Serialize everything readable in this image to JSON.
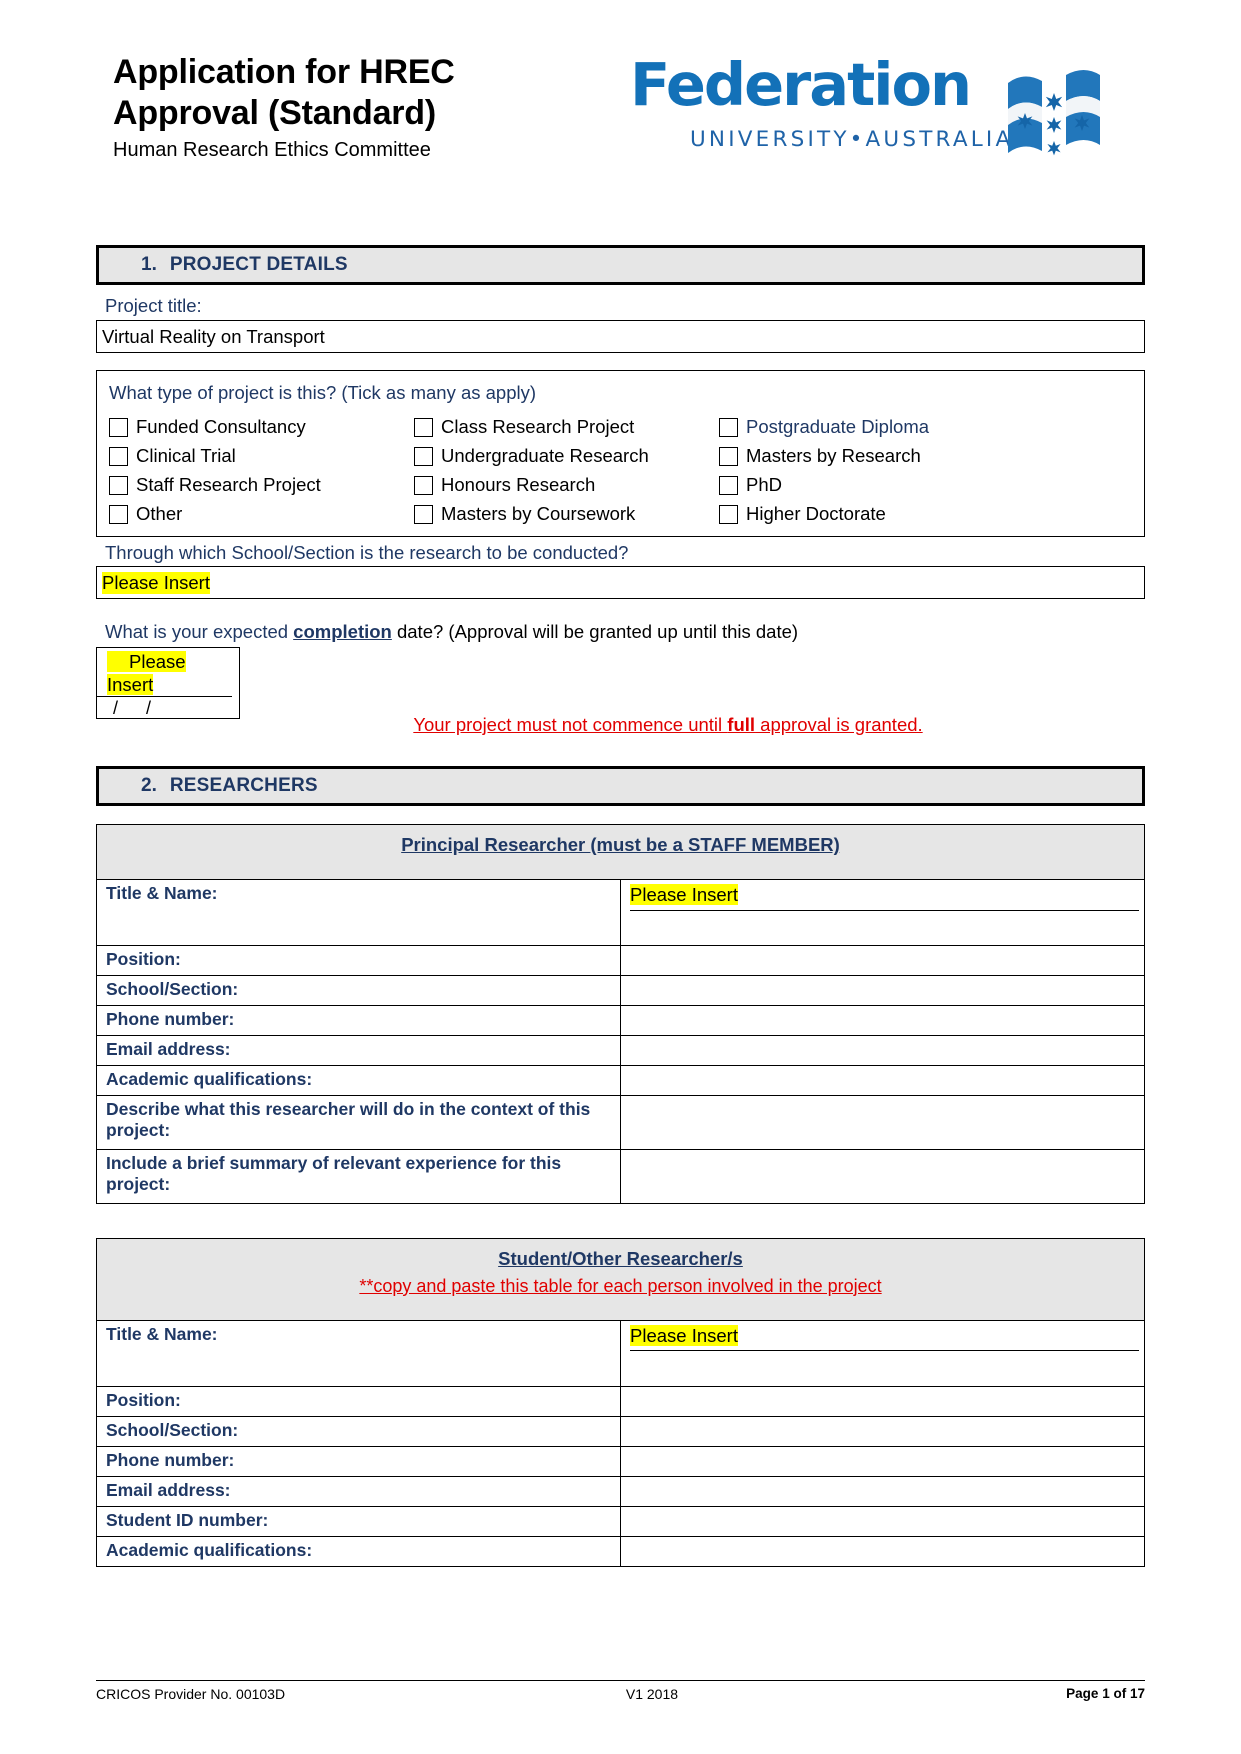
{
  "header": {
    "title": "Application for HREC Approval (Standard)",
    "subtitle": "Human Research Ethics Committee",
    "logo_word": "Federation",
    "logo_sub": "UNIVERSITY•AUSTRALIA",
    "logo_brand_color": "#1371b8"
  },
  "section1": {
    "number": "1.",
    "label": "PROJECT DETAILS",
    "project_title_label": "Project title:",
    "project_title_value": "Virtual Reality on Transport",
    "project_type_question": "What type of project is this? (Tick as many as apply)",
    "project_types": [
      {
        "label": "Funded Consultancy",
        "checked": false,
        "color": "black"
      },
      {
        "label": "Class Research Project",
        "checked": false,
        "color": "black"
      },
      {
        "label": "Postgraduate Diploma",
        "checked": false,
        "color": "navy"
      },
      {
        "label": "Clinical Trial",
        "checked": false,
        "color": "black"
      },
      {
        "label": "Undergraduate Research",
        "checked": false,
        "color": "black"
      },
      {
        "label": "Masters by Research",
        "checked": false,
        "color": "black"
      },
      {
        "label": "Staff Research Project",
        "checked": false,
        "color": "black"
      },
      {
        "label": "Honours Research",
        "checked": false,
        "color": "black"
      },
      {
        "label": "PhD",
        "checked": false,
        "color": "black"
      },
      {
        "label": "Other",
        "checked": false,
        "color": "black"
      },
      {
        "label": "Masters by Coursework",
        "checked": false,
        "color": "black"
      },
      {
        "label": "Higher Doctorate",
        "checked": false,
        "color": "black"
      }
    ],
    "school_question": "Through which School/Section is the research to be conducted?",
    "school_value": "Please Insert",
    "completion_q_part1": "What is your expected ",
    "completion_q_bold": "completion",
    "completion_q_part2": " date? (Approval will be granted up until this date)",
    "date_value_line1": "Please",
    "date_value_line2": "Insert",
    "date_slash_1": "/",
    "date_slash_2": "/",
    "warning_part1": "Your project must not commence until ",
    "warning_bold": "full",
    "warning_part2": " approval is granted.",
    "warning_color": "#e00000"
  },
  "section2": {
    "number": "2.",
    "label": "RESEARCHERS",
    "principal_table": {
      "header": "Principal Researcher (must be a STAFF MEMBER)",
      "rows": [
        {
          "label": "Title & Name:",
          "value": "Please Insert",
          "highlight": true,
          "tall": true
        },
        {
          "label": "Position:",
          "value": ""
        },
        {
          "label": "School/Section:",
          "value": ""
        },
        {
          "label": "Phone number:",
          "value": ""
        },
        {
          "label": "Email address:",
          "value": ""
        },
        {
          "label": "Academic qualifications:",
          "value": ""
        },
        {
          "label": "Describe what this researcher will do in the context of this project:",
          "value": "",
          "twoline": true
        },
        {
          "label": "Include a brief summary of relevant experience for this project:",
          "value": "",
          "twoline": true
        }
      ]
    },
    "student_table": {
      "header": "Student/Other Researcher/s",
      "header_note": "**copy and paste this table for each person involved in the project",
      "rows": [
        {
          "label": "Title & Name:",
          "value": "Please Insert",
          "highlight": true,
          "tall": true
        },
        {
          "label": "Position:",
          "value": ""
        },
        {
          "label": "School/Section:",
          "value": ""
        },
        {
          "label": "Phone number:",
          "value": ""
        },
        {
          "label": "Email address:",
          "value": ""
        },
        {
          "label": "Student ID number:",
          "value": ""
        },
        {
          "label": "Academic qualifications:",
          "value": ""
        }
      ]
    }
  },
  "footer": {
    "cricos": "CRICOS Provider No. 00103D",
    "version": "V1   2018",
    "page": "Page 1 of 17"
  }
}
